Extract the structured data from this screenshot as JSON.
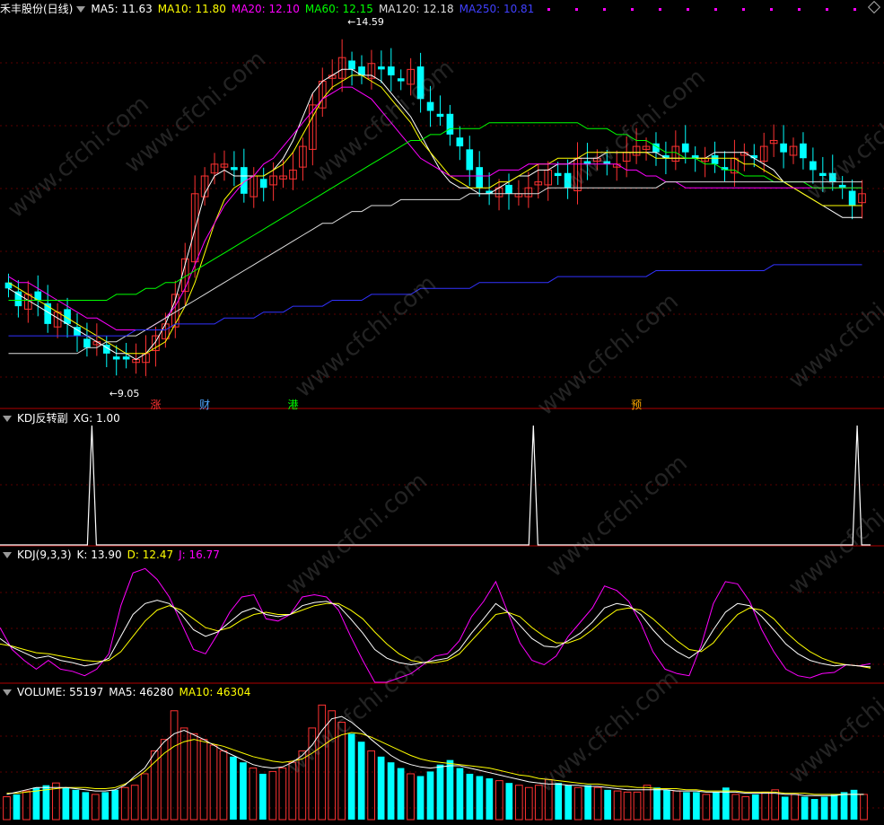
{
  "header": {
    "stock": "禾丰股份(日线)",
    "ma5": "MA5: 11.63",
    "ma10": "MA10: 11.80",
    "ma20": "MA20: 12.10",
    "ma60": "MA60: 12.15",
    "ma120": "MA120: 12.18",
    "ma250": "MA250: 10.81"
  },
  "annotations": {
    "high": "14.59",
    "low": "9.05"
  },
  "markers": [
    "涨",
    "财",
    "港",
    "预"
  ],
  "panels": {
    "kdj_reversal": {
      "title": "KDJ反转副",
      "xg": "XG: 1.00"
    },
    "kdj": {
      "title": "KDJ(9,3,3)",
      "k": "K: 13.90",
      "d": "D: 12.47",
      "j": "J: 16.77"
    },
    "volume": {
      "title": "VOLUME: 55197",
      "ma5": "MA5: 46280",
      "ma10": "MA10: 46304"
    }
  },
  "watermark": "www.cfchi.com",
  "colors": {
    "up": "#ff3232",
    "down": "#00ffff",
    "ma5": "#ffffff",
    "ma10": "#ffff00",
    "ma20": "#ff00ff",
    "ma60": "#00ff00",
    "ma120": "#dcdcdc",
    "ma250": "#3232ff"
  },
  "chart_data": {
    "type": "candlestick",
    "price_ylim": [
      8.6,
      15.0
    ],
    "closes": [
      10.4,
      10.1,
      10.3,
      10.2,
      9.8,
      10.0,
      9.8,
      9.6,
      9.4,
      9.5,
      9.3,
      9.2,
      9.2,
      9.2,
      9.3,
      9.6,
      9.8,
      10.3,
      10.9,
      12.0,
      12.3,
      12.5,
      12.5,
      12.4,
      12.0,
      12.3,
      12.1,
      12.3,
      12.3,
      12.4,
      12.8,
      13.5,
      13.9,
      14.0,
      14.3,
      14.1,
      14.0,
      14.2,
      14.1,
      14.0,
      13.9,
      14.1,
      13.6,
      13.4,
      13.3,
      13.0,
      12.8,
      12.4,
      12.1,
      12.0,
      12.1,
      12.0,
      12.0,
      12.1,
      12.2,
      12.4,
      12.3,
      12.1,
      12.6,
      12.5,
      12.6,
      12.5,
      12.5,
      12.7,
      12.8,
      12.8,
      12.7,
      12.6,
      12.8,
      12.7,
      12.6,
      12.6,
      12.5,
      12.4,
      12.6,
      12.7,
      12.6,
      12.8,
      12.9,
      12.7,
      12.8,
      12.6,
      12.4,
      12.3,
      12.2,
      12.1,
      11.8,
      12.0
    ],
    "ma_lines": {
      "MA5": [
        10.4,
        10.3,
        10.2,
        10.1,
        10.0,
        9.9,
        9.8,
        9.7,
        9.6,
        9.5,
        9.4,
        9.3,
        9.3,
        9.2,
        9.3,
        9.5,
        9.8,
        10.2,
        10.8,
        11.4,
        12.0,
        12.3,
        12.4,
        12.3,
        12.3,
        12.3,
        12.3,
        12.4,
        12.6,
        12.9,
        13.3,
        13.7,
        13.9,
        14.0,
        14.1,
        14.1,
        14.0,
        14.0,
        13.9,
        13.7,
        13.5,
        13.3,
        13.0,
        12.7,
        12.4,
        12.2,
        12.1,
        12.1,
        12.0,
        12.0,
        12.1,
        12.2,
        12.3,
        12.3,
        12.4,
        12.4,
        12.5,
        12.5,
        12.6,
        12.6,
        12.6,
        12.7,
        12.7,
        12.7,
        12.7,
        12.7,
        12.7,
        12.6,
        12.6,
        12.6,
        12.6,
        12.6,
        12.7,
        12.7,
        12.7,
        12.7,
        12.6,
        12.5,
        12.4,
        12.2,
        12.1,
        12.0,
        11.9,
        11.8,
        11.7,
        11.6,
        11.6,
        11.6
      ],
      "MA10": [
        10.5,
        10.4,
        10.3,
        10.2,
        10.1,
        10.0,
        9.9,
        9.8,
        9.7,
        9.6,
        9.5,
        9.4,
        9.3,
        9.3,
        9.3,
        9.4,
        9.5,
        9.8,
        10.1,
        10.5,
        11.0,
        11.5,
        11.9,
        12.1,
        12.2,
        12.3,
        12.3,
        12.4,
        12.5,
        12.7,
        13.0,
        13.3,
        13.6,
        13.8,
        13.9,
        14.0,
        14.0,
        13.9,
        13.8,
        13.6,
        13.4,
        13.2,
        12.9,
        12.7,
        12.5,
        12.3,
        12.2,
        12.1,
        12.1,
        12.1,
        12.2,
        12.2,
        12.3,
        12.4,
        12.5,
        12.5,
        12.6,
        12.6,
        12.6,
        12.7,
        12.7,
        12.7,
        12.7,
        12.7,
        12.7,
        12.7,
        12.6,
        12.6,
        12.6,
        12.6,
        12.6,
        12.6,
        12.6,
        12.6,
        12.6,
        12.5,
        12.5,
        12.4,
        12.3,
        12.2,
        12.1,
        12.0,
        11.9,
        11.8,
        11.8,
        11.8,
        11.8,
        11.8
      ],
      "MA20": [
        10.6,
        10.5,
        10.5,
        10.4,
        10.3,
        10.2,
        10.1,
        10.0,
        9.9,
        9.9,
        9.8,
        9.7,
        9.7,
        9.7,
        9.7,
        9.8,
        9.9,
        10.1,
        10.4,
        10.8,
        11.2,
        11.5,
        11.8,
        12.0,
        12.2,
        12.3,
        12.5,
        12.6,
        12.8,
        13.0,
        13.2,
        13.4,
        13.6,
        13.7,
        13.8,
        13.8,
        13.7,
        13.6,
        13.4,
        13.2,
        13.0,
        12.8,
        12.6,
        12.5,
        12.4,
        12.3,
        12.3,
        12.3,
        12.3,
        12.3,
        12.4,
        12.4,
        12.4,
        12.5,
        12.5,
        12.5,
        12.5,
        12.5,
        12.5,
        12.5,
        12.5,
        12.5,
        12.5,
        12.4,
        12.4,
        12.3,
        12.3,
        12.2,
        12.2,
        12.1,
        12.1,
        12.1,
        12.1,
        12.1,
        12.1,
        12.1,
        12.1,
        12.1,
        12.1,
        12.1,
        12.1,
        12.1,
        12.1,
        12.1,
        12.1,
        12.1,
        12.1,
        12.1
      ],
      "MA60": [
        10.2,
        10.2,
        10.2,
        10.2,
        10.2,
        10.2,
        10.2,
        10.2,
        10.2,
        10.2,
        10.2,
        10.3,
        10.3,
        10.3,
        10.4,
        10.4,
        10.5,
        10.5,
        10.6,
        10.7,
        10.8,
        10.9,
        11.0,
        11.1,
        11.2,
        11.3,
        11.4,
        11.5,
        11.6,
        11.7,
        11.8,
        11.9,
        12.0,
        12.1,
        12.2,
        12.3,
        12.4,
        12.5,
        12.6,
        12.7,
        12.8,
        12.9,
        12.9,
        13.0,
        13.0,
        13.1,
        13.1,
        13.1,
        13.1,
        13.2,
        13.2,
        13.2,
        13.2,
        13.2,
        13.2,
        13.2,
        13.2,
        13.2,
        13.2,
        13.1,
        13.1,
        13.1,
        13.0,
        13.0,
        12.9,
        12.9,
        12.8,
        12.7,
        12.7,
        12.6,
        12.6,
        12.5,
        12.5,
        12.4,
        12.4,
        12.3,
        12.3,
        12.3,
        12.2,
        12.2,
        12.2,
        12.2,
        12.1,
        12.1,
        12.1,
        12.1,
        12.1,
        12.1
      ],
      "MA120": [
        9.3,
        9.3,
        9.3,
        9.3,
        9.3,
        9.3,
        9.3,
        9.3,
        9.4,
        9.4,
        9.5,
        9.5,
        9.6,
        9.6,
        9.7,
        9.8,
        9.9,
        10.0,
        10.1,
        10.2,
        10.3,
        10.4,
        10.5,
        10.6,
        10.7,
        10.8,
        10.9,
        11.0,
        11.1,
        11.2,
        11.3,
        11.4,
        11.5,
        11.5,
        11.6,
        11.7,
        11.7,
        11.8,
        11.8,
        11.8,
        11.9,
        11.9,
        11.9,
        11.9,
        11.9,
        11.9,
        11.9,
        12.0,
        12.0,
        12.0,
        12.0,
        12.0,
        12.0,
        12.0,
        12.0,
        12.1,
        12.1,
        12.1,
        12.1,
        12.1,
        12.1,
        12.1,
        12.1,
        12.1,
        12.1,
        12.1,
        12.1,
        12.2,
        12.2,
        12.2,
        12.2,
        12.2,
        12.2,
        12.2,
        12.2,
        12.2,
        12.2,
        12.2,
        12.2,
        12.2,
        12.2,
        12.2,
        12.2,
        12.2,
        12.2,
        12.2,
        12.2,
        12.2
      ],
      "MA250": [
        9.6,
        9.6,
        9.6,
        9.6,
        9.6,
        9.6,
        9.6,
        9.6,
        9.6,
        9.6,
        9.6,
        9.6,
        9.6,
        9.7,
        9.7,
        9.7,
        9.7,
        9.8,
        9.8,
        9.8,
        9.8,
        9.8,
        9.9,
        9.9,
        9.9,
        9.9,
        10.0,
        10.0,
        10.0,
        10.1,
        10.1,
        10.1,
        10.1,
        10.2,
        10.2,
        10.2,
        10.2,
        10.3,
        10.3,
        10.3,
        10.3,
        10.3,
        10.4,
        10.4,
        10.4,
        10.4,
        10.4,
        10.4,
        10.5,
        10.5,
        10.5,
        10.5,
        10.5,
        10.5,
        10.5,
        10.5,
        10.6,
        10.6,
        10.6,
        10.6,
        10.6,
        10.6,
        10.6,
        10.6,
        10.6,
        10.6,
        10.7,
        10.7,
        10.7,
        10.7,
        10.7,
        10.7,
        10.7,
        10.7,
        10.7,
        10.7,
        10.7,
        10.7,
        10.8,
        10.8,
        10.8,
        10.8,
        10.8,
        10.8,
        10.8,
        10.8,
        10.8,
        10.8
      ]
    },
    "kdj_reversal_signal_index": [
      9,
      54,
      87
    ],
    "kdj_ylim": [
      0,
      100
    ],
    "kdj": {
      "K": [
        40,
        32,
        27,
        22,
        24,
        20,
        18,
        15,
        17,
        22,
        42,
        62,
        72,
        75,
        72,
        62,
        48,
        42,
        46,
        55,
        64,
        68,
        62,
        60,
        62,
        70,
        73,
        74,
        70,
        58,
        45,
        30,
        22,
        18,
        16,
        18,
        20,
        22,
        30,
        45,
        58,
        72,
        64,
        52,
        40,
        33,
        32,
        38,
        45,
        55,
        68,
        72,
        70,
        62,
        48,
        36,
        28,
        22,
        30,
        48,
        64,
        72,
        70,
        60,
        48,
        35,
        26,
        20,
        17,
        15,
        16,
        15,
        14
      ],
      "D": [
        35,
        33,
        30,
        27,
        26,
        24,
        22,
        20,
        19,
        20,
        28,
        42,
        56,
        66,
        70,
        66,
        58,
        50,
        47,
        50,
        57,
        62,
        64,
        62,
        62,
        66,
        70,
        72,
        72,
        66,
        58,
        46,
        35,
        26,
        20,
        18,
        18,
        20,
        26,
        38,
        50,
        62,
        64,
        60,
        50,
        42,
        36,
        36,
        40,
        48,
        58,
        66,
        68,
        66,
        58,
        48,
        38,
        30,
        28,
        36,
        50,
        62,
        68,
        66,
        58,
        46,
        36,
        28,
        22,
        18,
        16,
        15,
        13
      ],
      "J": [
        50,
        30,
        20,
        12,
        20,
        12,
        10,
        6,
        12,
        26,
        70,
        100,
        104,
        94,
        78,
        54,
        30,
        26,
        44,
        64,
        78,
        80,
        58,
        56,
        62,
        78,
        80,
        78,
        66,
        42,
        20,
        0,
        0,
        4,
        8,
        16,
        24,
        26,
        38,
        60,
        74,
        92,
        64,
        36,
        20,
        16,
        24,
        42,
        55,
        68,
        88,
        84,
        74,
        54,
        28,
        12,
        8,
        6,
        34,
        72,
        92,
        90,
        74,
        48,
        28,
        12,
        6,
        4,
        8,
        9,
        16,
        15,
        17
      ],
      "values": {
        "K": 13.9,
        "D": 12.47,
        "J": 16.77
      }
    },
    "volume": {
      "values": [
        20,
        22,
        25,
        28,
        30,
        32,
        28,
        26,
        24,
        22,
        24,
        26,
        28,
        30,
        40,
        60,
        70,
        95,
        80,
        75,
        70,
        65,
        60,
        55,
        50,
        45,
        40,
        42,
        45,
        50,
        60,
        80,
        100,
        95,
        85,
        75,
        68,
        60,
        55,
        50,
        45,
        40,
        38,
        42,
        48,
        52,
        45,
        40,
        38,
        36,
        34,
        32,
        30,
        28,
        30,
        35,
        32,
        30,
        28,
        30,
        28,
        26,
        25,
        24,
        24,
        30,
        28,
        26,
        25,
        24,
        24,
        22,
        24,
        28,
        22,
        20,
        22,
        24,
        26,
        20,
        22,
        20,
        18,
        20,
        22,
        24,
        26,
        22
      ],
      "ma5": [
        22,
        24,
        26,
        28,
        28,
        28,
        28,
        27,
        26,
        25,
        25,
        26,
        30,
        38,
        45,
        58,
        68,
        75,
        78,
        74,
        70,
        65,
        60,
        56,
        52,
        48,
        46,
        45,
        46,
        50,
        56,
        65,
        78,
        88,
        90,
        85,
        78,
        70,
        63,
        56,
        51,
        48,
        46,
        45,
        46,
        47,
        47,
        45,
        43,
        41,
        39,
        37,
        35,
        33,
        32,
        31,
        31,
        30,
        30,
        29,
        29,
        28,
        27,
        26,
        26,
        26,
        26,
        26,
        25,
        25,
        25,
        24,
        24,
        24,
        24,
        23,
        23,
        23,
        23,
        22,
        22,
        21,
        21,
        21,
        21,
        22,
        22,
        22
      ],
      "ma10": [
        23,
        23,
        24,
        25,
        26,
        27,
        28,
        28,
        28,
        27,
        27,
        28,
        31,
        36,
        42,
        50,
        58,
        64,
        68,
        70,
        68,
        66,
        64,
        61,
        58,
        55,
        53,
        51,
        50,
        51,
        53,
        58,
        64,
        70,
        74,
        76,
        75,
        72,
        68,
        64,
        60,
        56,
        53,
        51,
        50,
        49,
        48,
        47,
        46,
        45,
        43,
        41,
        39,
        38,
        36,
        35,
        34,
        33,
        32,
        31,
        31,
        30,
        29,
        29,
        28,
        28,
        27,
        27,
        27,
        26,
        26,
        25,
        25,
        25,
        25,
        24,
        24,
        24,
        24,
        23,
        23,
        23,
        22,
        22,
        22,
        22,
        22,
        22
      ],
      "values_text": {
        "volume": 55197,
        "ma5": 46280,
        "ma10": 46304
      }
    }
  }
}
